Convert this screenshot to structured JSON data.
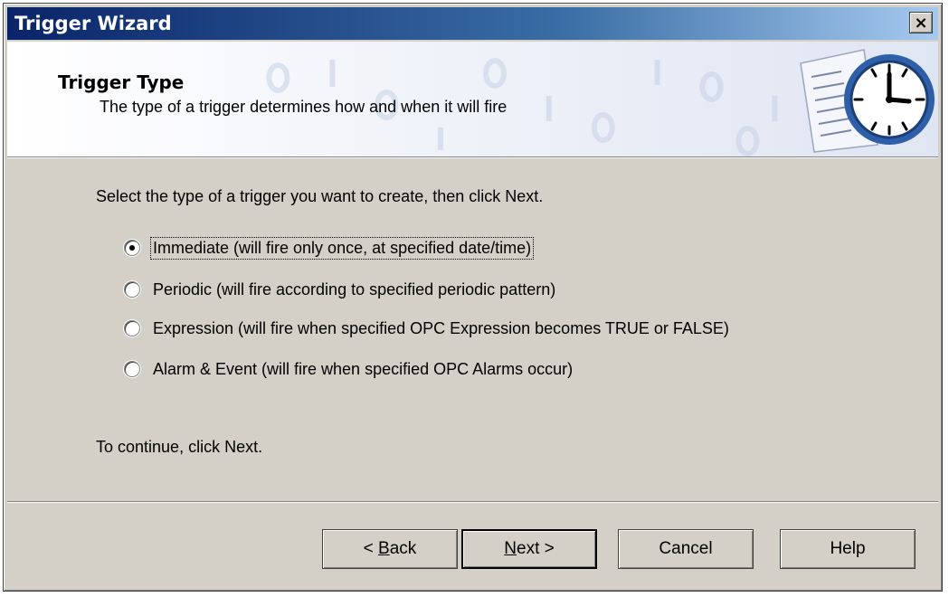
{
  "window": {
    "title": "Trigger Wizard",
    "close_label": "×"
  },
  "header": {
    "title": "Trigger Type",
    "subtitle": "The type of a trigger determines how and when it will fire",
    "icon": "clock-calendar-icon"
  },
  "body": {
    "instruction": "Select the type of a trigger you want to create, then click Next.",
    "options": [
      {
        "label": "Immediate (will fire only once, at specified date/time)",
        "checked": true
      },
      {
        "label": "Periodic (will fire according to specified periodic pattern)",
        "checked": false
      },
      {
        "label": "Expression (will fire when specified OPC Expression becomes TRUE or FALSE)",
        "checked": false
      },
      {
        "label": "Alarm & Event (will fire when specified OPC Alarms occur)",
        "checked": false
      }
    ],
    "continue_text": "To continue, click Next."
  },
  "buttons": {
    "back_prefix": "< ",
    "back_mnemonic": "B",
    "back_rest": "ack",
    "next_mnemonic": "N",
    "next_rest": "ext >",
    "cancel": "Cancel",
    "help": "Help"
  },
  "colors": {
    "titlebar_start": "#0a246a",
    "titlebar_end": "#a6caf0",
    "dialog_face": "#d4d0c8"
  }
}
